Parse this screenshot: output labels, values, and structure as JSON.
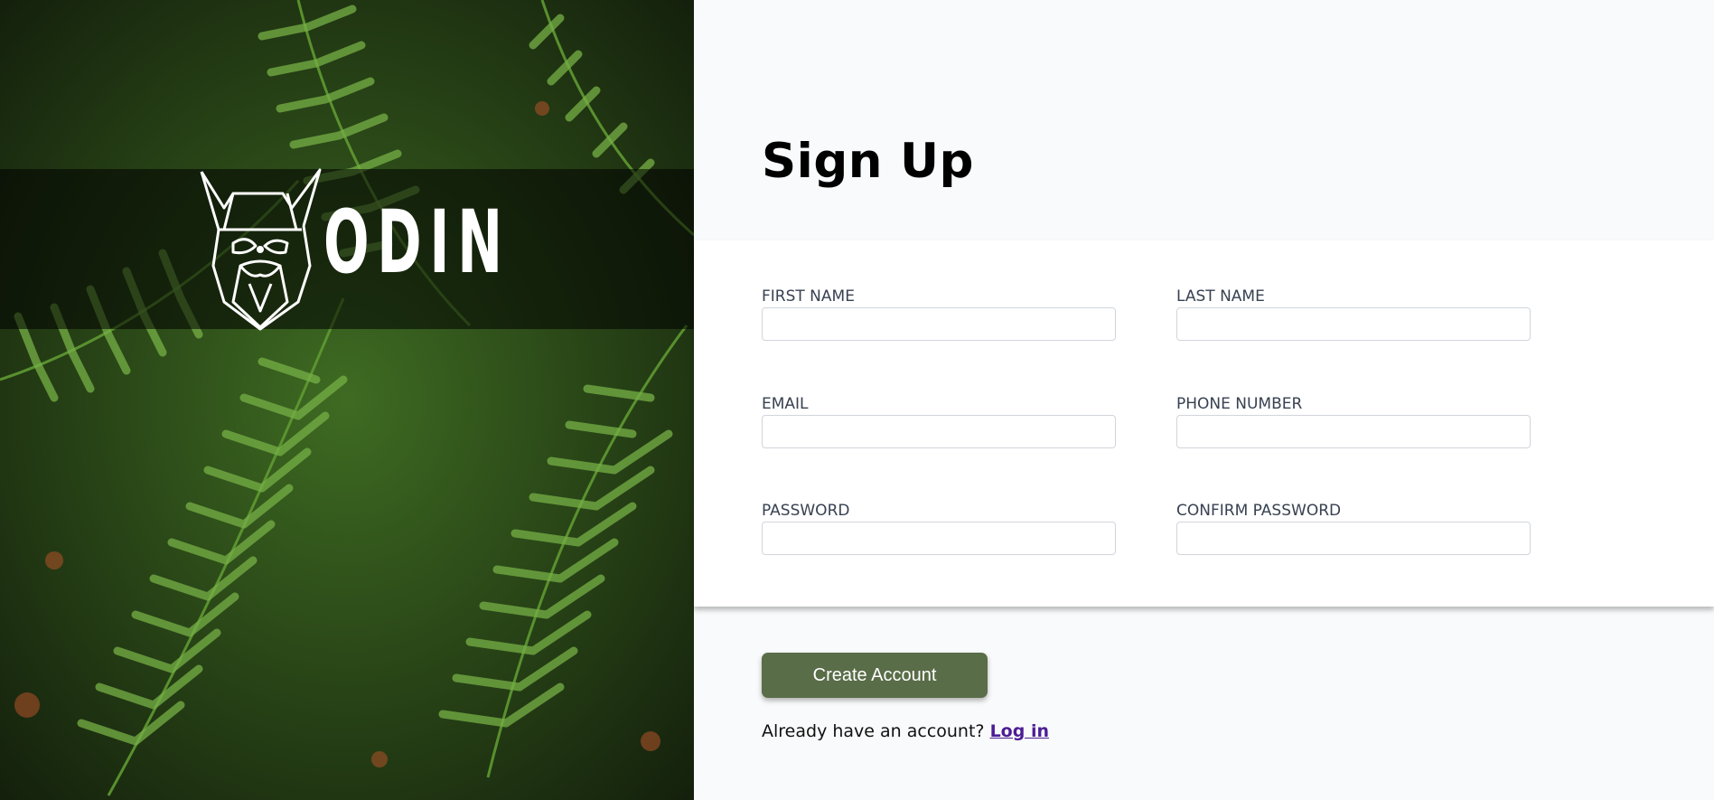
{
  "brand": {
    "name": "ODIN",
    "logo_icon": "viking-head-icon"
  },
  "hero": {
    "background": "fern-leaves-photo"
  },
  "signup": {
    "title": "Sign Up",
    "fields": {
      "first_name": {
        "label": "FIRST NAME",
        "value": ""
      },
      "last_name": {
        "label": "LAST NAME",
        "value": ""
      },
      "email": {
        "label": "EMAIL",
        "value": ""
      },
      "phone": {
        "label": "PHONE NUMBER",
        "value": ""
      },
      "password": {
        "label": "PASSWORD",
        "value": ""
      },
      "confirm_password": {
        "label": "CONFIRM PASSWORD",
        "value": ""
      }
    },
    "submit_label": "Create Account",
    "login_prompt": "Already have an account?",
    "login_link": "Log in"
  },
  "colors": {
    "button": "#596d48",
    "link": "#4c1d95",
    "label": "#374151",
    "panel_bg": "#f9fafb"
  }
}
